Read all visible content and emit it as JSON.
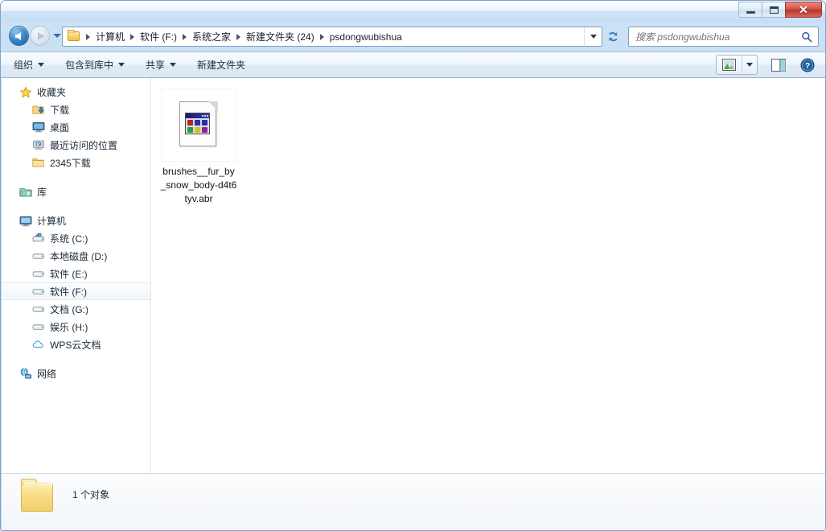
{
  "window": {
    "title": "",
    "buttons": {
      "minimize": "minimize",
      "maximize": "restore",
      "close": "close"
    }
  },
  "navigation": {
    "back_label": "后退",
    "forward_label": "前进",
    "history_label": "最近浏览的页面",
    "refresh_label": "刷新"
  },
  "address": {
    "breadcrumbs": [
      {
        "label": "计算机"
      },
      {
        "label": "软件 (F:)"
      },
      {
        "label": "系统之家"
      },
      {
        "label": "新建文件夹 (24)"
      },
      {
        "label": "psdongwubishua"
      }
    ],
    "dropdown_label": "以前的位置"
  },
  "search": {
    "placeholder": "搜索 psdongwubishua",
    "value": "",
    "icon": "search-icon"
  },
  "toolbar": {
    "items": [
      {
        "label": "组织",
        "has_caret": true
      },
      {
        "label": "包含到库中",
        "has_caret": true
      },
      {
        "label": "共享",
        "has_caret": true
      },
      {
        "label": "新建文件夹",
        "has_caret": false
      }
    ],
    "view_label": "更改您的视图",
    "view_caret_label": "视图选项",
    "preview_label": "显示预览窗格",
    "help_label": "获取帮助"
  },
  "sidebar": {
    "groups": [
      {
        "root": {
          "label": "收藏夹",
          "icon": "star-icon"
        },
        "children": [
          {
            "label": "下载",
            "icon": "download-folder-icon"
          },
          {
            "label": "桌面",
            "icon": "desktop-icon"
          },
          {
            "label": "最近访问的位置",
            "icon": "recent-places-icon"
          },
          {
            "label": "2345下载",
            "icon": "folder-icon"
          }
        ]
      },
      {
        "root": {
          "label": "库",
          "icon": "library-icon"
        },
        "children": []
      },
      {
        "root": {
          "label": "计算机",
          "icon": "computer-icon"
        },
        "children": [
          {
            "label": "系统 (C:)",
            "icon": "system-drive-icon",
            "selected": false
          },
          {
            "label": "本地磁盘 (D:)",
            "icon": "drive-icon",
            "selected": false
          },
          {
            "label": "软件 (E:)",
            "icon": "drive-icon",
            "selected": false
          },
          {
            "label": "软件 (F:)",
            "icon": "drive-icon",
            "selected": true
          },
          {
            "label": "文档 (G:)",
            "icon": "drive-icon",
            "selected": false
          },
          {
            "label": "娱乐 (H:)",
            "icon": "drive-icon",
            "selected": false
          },
          {
            "label": "WPS云文档",
            "icon": "cloud-icon",
            "selected": false
          }
        ]
      },
      {
        "root": {
          "label": "网络",
          "icon": "network-icon"
        },
        "children": []
      }
    ]
  },
  "content": {
    "files": [
      {
        "name": "brushes__fur_by_snow_body-d4t6tyv.abr",
        "icon": "generic-program-file-icon"
      }
    ]
  },
  "statusbar": {
    "text": "1 个对象",
    "icon": "folder-icon"
  },
  "colors": {
    "accent": "#3d86c6",
    "close_button": "#b93428",
    "frame": "#bdd7ef",
    "toolbar_bg": "#e6eff9",
    "selection": "#f1f6fb"
  }
}
